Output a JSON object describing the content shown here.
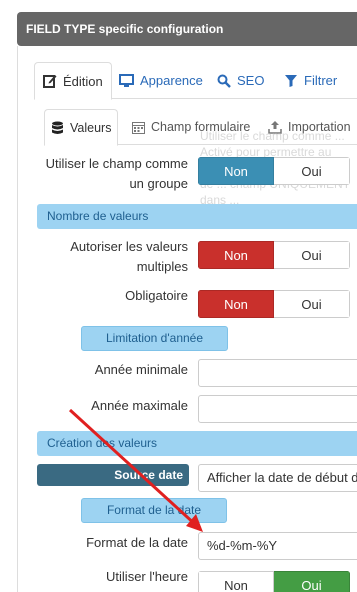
{
  "panel": {
    "title": "FIELD TYPE specific configuration"
  },
  "main_tabs": [
    {
      "label": "Édition",
      "icon": "edit-icon",
      "active": true
    },
    {
      "label": "Apparence",
      "icon": "monitor-icon",
      "active": false
    },
    {
      "label": "SEO",
      "icon": "search-icon",
      "active": false
    },
    {
      "label": "Filtrer",
      "icon": "filter-icon",
      "active": false
    }
  ],
  "sub_tabs": [
    {
      "label": "Valeurs",
      "icon": "database-icon",
      "active": true
    },
    {
      "label": "Champ formulaire",
      "icon": "calendar-icon",
      "active": false
    },
    {
      "label": "Importation",
      "icon": "upload-icon",
      "active": false
    }
  ],
  "ghost_help": "Utiliser le champ comme ... Activé pour permettre au champ \"Groupe de champs\" de ... champ UNIQUEMENT dans ...",
  "fields": {
    "group": {
      "label_line1": "Utiliser le champ comme",
      "label_line2": "un groupe",
      "no": "Non",
      "yes": "Oui",
      "selected": "no"
    },
    "section_values": "Nombre de valeurs",
    "multiple": {
      "label_line1": "Autoriser les valeurs",
      "label_line2": "multiples",
      "no": "Non",
      "yes": "Oui",
      "selected": "no"
    },
    "required": {
      "label": "Obligatoire",
      "no": "Non",
      "yes": "Oui",
      "selected": "no"
    },
    "year_limit": "Limitation d'année",
    "min_year": {
      "label": "Année minimale",
      "value": ""
    },
    "max_year": {
      "label": "Année maximale",
      "value": ""
    },
    "section_creation": "Création des valeurs",
    "date_source": {
      "label": "Source date",
      "value": "Afficher la date de début d"
    },
    "date_format_title": "Format de la date",
    "date_format": {
      "label": "Format de la date",
      "value": "%d-%m-%Y"
    },
    "use_time": {
      "label": "Utiliser l'heure",
      "no": "Non",
      "yes": "Oui",
      "selected": "yes"
    }
  },
  "colors": {
    "header_bg": "#666666",
    "section_bg": "#9dd3f2",
    "blue_active": "#3b8fb4",
    "red_active": "#c9302c",
    "green_active": "#449d44",
    "arrow": "#e02020"
  }
}
